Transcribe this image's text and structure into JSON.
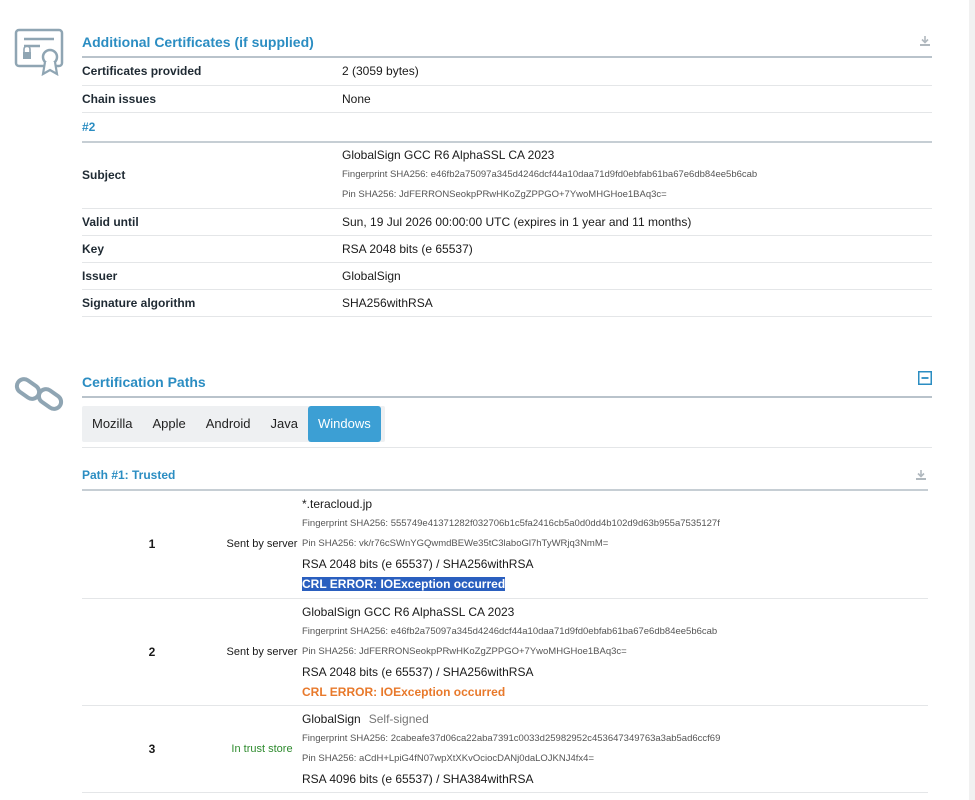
{
  "certificates": {
    "title": "Additional Certificates (if supplied)",
    "rows": [
      {
        "label": "Certificates provided",
        "value": "2 (3059 bytes)"
      },
      {
        "label": "Chain issues",
        "value": "None"
      }
    ],
    "cert_number": "#2",
    "subject": {
      "label": "Subject",
      "name": "GlobalSign GCC R6 AlphaSSL CA 2023",
      "fingerprint": "Fingerprint SHA256: e46fb2a75097a345d4246dcf44a10daa71d9fd0ebfab61ba67e6db84ee5b6cab",
      "pin": "Pin SHA256: JdFERRONSeokpPRwHKoZgZPPGO+7YwoMHGHoe1BAq3c="
    },
    "details": [
      {
        "label": "Valid until",
        "value": "Sun, 19 Jul 2026 00:00:00 UTC (expires in 1 year and 11 months)"
      },
      {
        "label": "Key",
        "value": "RSA 2048 bits (e 65537)"
      },
      {
        "label": "Issuer",
        "value": "GlobalSign"
      },
      {
        "label": "Signature algorithm",
        "value": "SHA256withRSA"
      }
    ]
  },
  "paths": {
    "title": "Certification Paths",
    "tabs": [
      "Mozilla",
      "Apple",
      "Android",
      "Java",
      "Windows"
    ],
    "active_tab": "Windows",
    "path_title": "Path #1: Trusted",
    "rows": [
      {
        "num": "1",
        "source": "Sent by server",
        "name": "*.teracloud.jp",
        "fingerprint": "Fingerprint SHA256: 555749e41371282f032706b1c5fa2416cb5a0d0dd4b102d9d63b955a7535127f",
        "pin": "Pin SHA256: vk/r76cSWnYGQwmdBEWe35tC3laboGl7hTyWRjq3NmM=",
        "key": "RSA 2048 bits (e 65537) / SHA256withRSA",
        "crl": "CRL ERROR: IOException occurred"
      },
      {
        "num": "2",
        "source": "Sent by server",
        "name": "GlobalSign GCC R6 AlphaSSL CA 2023",
        "fingerprint": "Fingerprint SHA256: e46fb2a75097a345d4246dcf44a10daa71d9fd0ebfab61ba67e6db84ee5b6cab",
        "pin": "Pin SHA256: JdFERRONSeokpPRwHKoZgZPPGO+7YwoMHGHoe1BAq3c=",
        "key": "RSA 2048 bits (e 65537) / SHA256withRSA",
        "crl": "CRL ERROR: IOException occurred"
      },
      {
        "num": "3",
        "source": "In trust store",
        "name": "GlobalSign",
        "self_signed": "Self-signed",
        "fingerprint": "Fingerprint SHA256: 2cabeafe37d06ca22aba7391c0033d25982952c453647349763a3ab5ad6ccf69",
        "pin": "Pin SHA256: aCdH+LpiG4fN07wpXtXKvOciocDANj0daLOJKNJ4fx4=",
        "key": "RSA 4096 bits (e 65537) / SHA384withRSA"
      }
    ]
  },
  "icons": {
    "certificate": "certificate-icon",
    "chain": "chain-link-icon",
    "download": "download-icon",
    "collapse": "collapse-minus-icon"
  },
  "colors": {
    "accent": "#2b8dc2",
    "tab_active": "#3c9fd4",
    "error": "#e8792b",
    "trusted": "#2e8b2e",
    "selection": "#2a5fbf"
  }
}
